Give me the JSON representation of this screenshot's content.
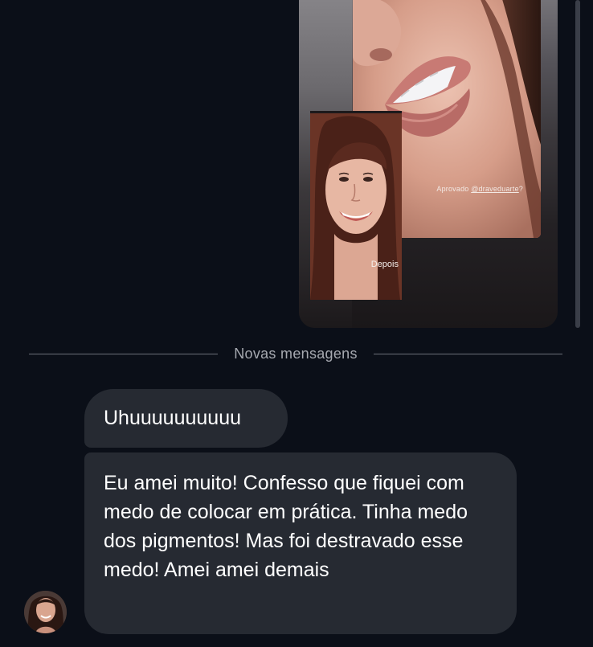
{
  "media": {
    "caption_prefix": "Aprovado ",
    "caption_handle": "@draveduarte",
    "caption_suffix": "?",
    "inset_label": "Depois"
  },
  "divider": {
    "label": "Novas mensagens"
  },
  "messages": [
    {
      "text": "Uhuuuuuuuuuu"
    },
    {
      "text": "Eu amei muito! Confesso que fiquei com medo de colocar em prática. Tinha medo dos pigmentos! Mas foi destravado esse medo! Amei amei demais"
    }
  ]
}
